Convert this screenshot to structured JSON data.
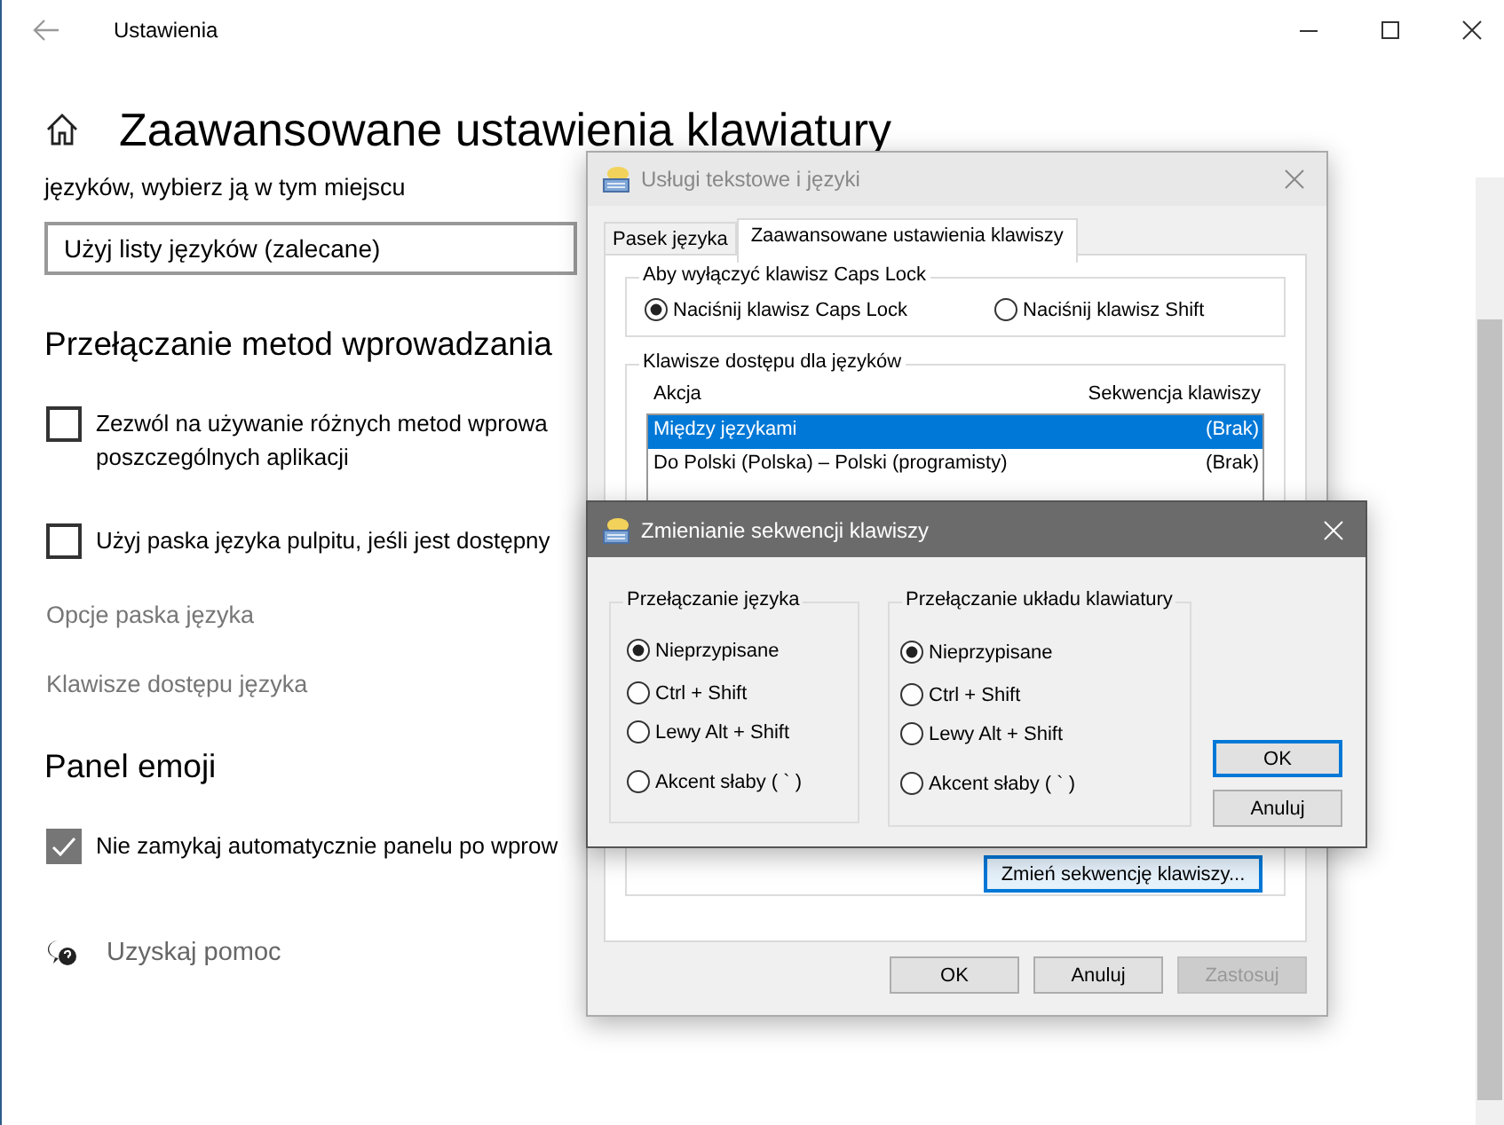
{
  "settings": {
    "title": "Ustawienia",
    "heading": "Zaawansowane ustawienia klawiatury",
    "intro": "języków, wybierz ją w tym miejscu",
    "dropdown": {
      "value": "Użyj listy języków (zalecane)"
    },
    "sections": [
      {
        "title": "Przełączanie metod wprowadzania",
        "items": [
          {
            "kind": "checkbox",
            "lines": [
              "Zezwól na używanie różnych metod wprowa",
              "poszczególnych aplikacji"
            ],
            "checked": false
          },
          {
            "kind": "checkbox",
            "lines": [
              "Użyj paska języka pulpitu, jeśli jest dostępny"
            ],
            "checked": false
          },
          {
            "kind": "link",
            "lines": [
              "Opcje paska języka"
            ]
          },
          {
            "kind": "link",
            "lines": [
              "Klawisze dostępu języka"
            ]
          }
        ]
      },
      {
        "title": "Panel emoji",
        "items": [
          {
            "kind": "checkbox",
            "lines": [
              "Nie zamykaj automatycznie panelu po wprow"
            ],
            "checked": true
          }
        ]
      }
    ],
    "help": "Uzyskaj pomoc"
  },
  "text_services_dialog": {
    "title": "Usługi tekstowe i języki",
    "tabs": [
      {
        "label": "Pasek języka",
        "selected": false
      },
      {
        "label": "Zaawansowane ustawienia klawiszy",
        "selected": true
      }
    ],
    "capslock_group": {
      "title": "Aby wyłączyć klawisz Caps Lock",
      "options": [
        {
          "label": "Naciśnij klawisz Caps Lock",
          "selected": true
        },
        {
          "label": "Naciśnij klawisz Shift",
          "selected": false
        }
      ]
    },
    "hotkeys_group": {
      "title": "Klawisze dostępu dla języków",
      "columns": [
        "Akcja",
        "Sekwencja klawiszy"
      ],
      "rows": [
        {
          "action": "Między językami",
          "sequence": "(Brak)",
          "selected": true
        },
        {
          "action": "Do Polski (Polska) – Polski (programisty)",
          "sequence": "(Brak)",
          "selected": false
        }
      ],
      "change_button": "Zmień sekwencję klawiszy..."
    },
    "buttons": [
      {
        "label": "OK",
        "disabled": false
      },
      {
        "label": "Anuluj",
        "disabled": false
      },
      {
        "label": "Zastosuj",
        "disabled": true
      }
    ]
  },
  "change_sequence_dialog": {
    "title": "Zmienianie sekwencji klawiszy",
    "groups": [
      {
        "title": "Przełączanie języka",
        "options": [
          {
            "label": "Nieprzypisane",
            "selected": true
          },
          {
            "label": "Ctrl + Shift",
            "selected": false
          },
          {
            "label": "Lewy Alt + Shift",
            "selected": false
          },
          {
            "label": "Akcent słaby ( ` )",
            "selected": false
          }
        ]
      },
      {
        "title": "Przełączanie układu klawiatury",
        "options": [
          {
            "label": "Nieprzypisane",
            "selected": true
          },
          {
            "label": "Ctrl + Shift",
            "selected": false
          },
          {
            "label": "Lewy Alt + Shift",
            "selected": false
          },
          {
            "label": "Akcent słaby ( ` )",
            "selected": false
          }
        ]
      }
    ],
    "buttons": [
      {
        "label": "OK",
        "default": true
      },
      {
        "label": "Anuluj",
        "default": false
      }
    ]
  }
}
